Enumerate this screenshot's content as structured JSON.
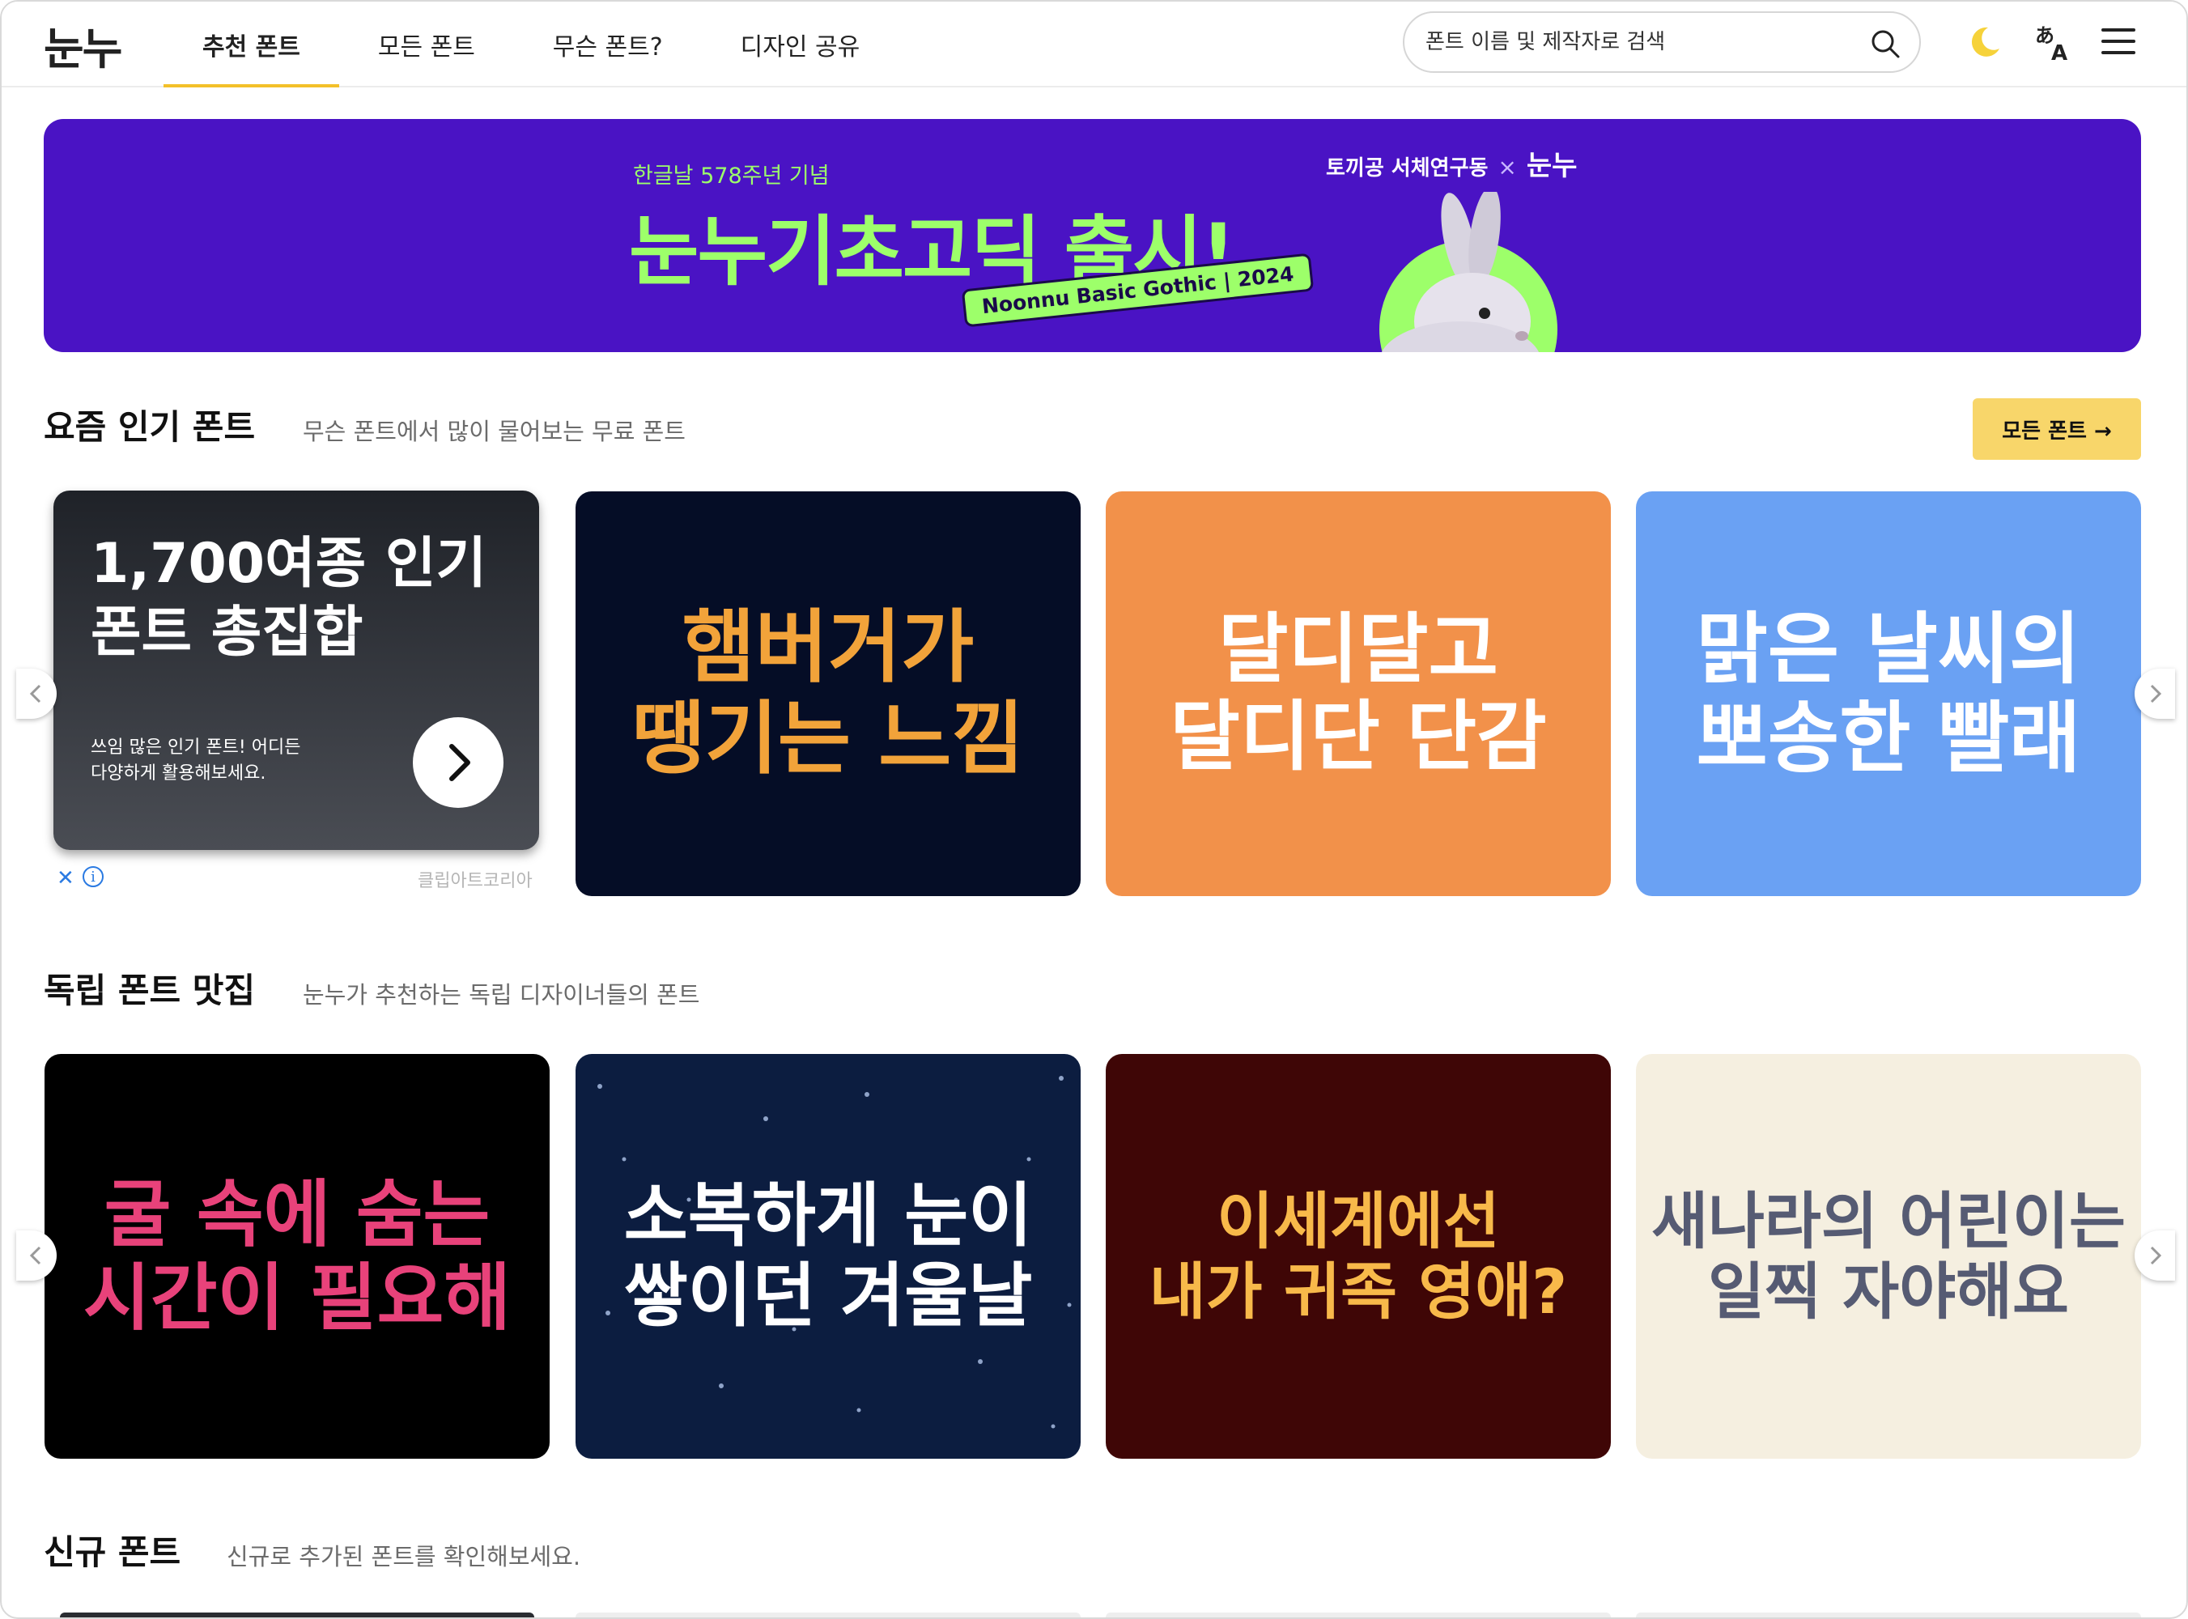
{
  "header": {
    "logo": "눈누",
    "nav": [
      {
        "label": "추천 폰트",
        "active": true
      },
      {
        "label": "모든 폰트",
        "active": false
      },
      {
        "label": "무슨 폰트?",
        "active": false
      },
      {
        "label": "디자인 공유",
        "active": false
      }
    ],
    "search_placeholder": "폰트 이름 및 제작자로 검색",
    "icons": [
      "search-icon",
      "moon-icon",
      "translate-icon",
      "menu-icon"
    ]
  },
  "banner": {
    "subtitle": "한글날 578주년 기념",
    "title": "눈누기초고딕 출시!",
    "tag": "Noonnu Basic Gothic | 2024",
    "collab_left": "토끼공 서체연구동",
    "collab_x": "×",
    "collab_right": "눈누",
    "bg_color": "#4a13c4",
    "accent_color": "#9dff6a"
  },
  "popular": {
    "title": "요즘 인기 폰트",
    "subtitle": "무슨 폰트에서 많이 물어보는 무료 폰트",
    "all_button": "모든 폰트 →",
    "ad": {
      "title": "1,700여종 인기\n폰트 총집합",
      "desc": "쓰임 많은 인기 폰트! 어디든\n다양하게 활용해보세요.",
      "close": "✕",
      "info": "i",
      "source": "클립아트코리아"
    },
    "cards": [
      {
        "text": "햄버거가\n땡기는 느낌",
        "bg": "#050d26",
        "color": "#f2a33a"
      },
      {
        "text": "달디달고\n달디단 단감",
        "bg": "#f2914a",
        "color": "#ffffff"
      },
      {
        "text": "맑은 날씨의\n뽀송한 빨래",
        "bg": "#6aa1f3",
        "color": "#ffffff"
      }
    ]
  },
  "indie": {
    "title": "독립 폰트 맛집",
    "subtitle": "눈누가 추천하는 독립 디자이너들의 폰트",
    "cards": [
      {
        "text": "굴 속에 숨는\n시간이 필요해",
        "bg": "#000000",
        "color": "#e8427a"
      },
      {
        "text": "소복하게 눈이\n쌓이던 겨울날",
        "bg": "#0c1d40",
        "color": "#ffffff"
      },
      {
        "text": "이세계에선\n내가 귀족 영애?",
        "bg": "#3f0606",
        "color": "#f8b94a"
      },
      {
        "text": "새나라의 어린이는\n일찍 자야해요",
        "bg": "#f5efe0",
        "color": "#565b73"
      }
    ]
  },
  "new_fonts": {
    "title": "신규 폰트",
    "subtitle": "신규로 추가된 폰트를 확인해보세요."
  }
}
